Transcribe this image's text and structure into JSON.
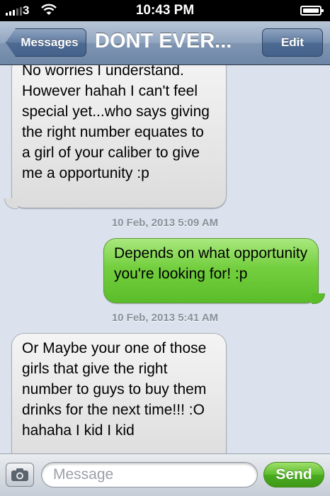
{
  "status_bar": {
    "carrier": "3",
    "time": "10:43 PM",
    "icons": [
      "signal-icon",
      "wifi-icon",
      "battery-icon"
    ]
  },
  "nav": {
    "back_label": "Messages",
    "title": "DONT EVER...",
    "edit_label": "Edit"
  },
  "messages": [
    {
      "direction": "incoming",
      "text": "No worries I understand. However hahah I can't feel special yet...who says giving the right number equates to a girl of your caliber to give me a opportunity :p"
    },
    {
      "direction": "outgoing",
      "text": "Depends on what opportunity you're looking for! :p"
    },
    {
      "direction": "incoming",
      "text": "Or Maybe your one of those girls that give the right number to guys to buy them drinks for the next time!!! :O hahaha I kid I kid"
    }
  ],
  "timestamps": [
    "10 Feb, 2013 5:09 AM",
    "10 Feb, 2013 5:41 AM"
  ],
  "input_bar": {
    "placeholder": "Message",
    "value": "",
    "send_label": "Send",
    "camera_icon": "camera-icon"
  },
  "colors": {
    "outgoing_bubble": "#74cf3f",
    "incoming_bubble": "#e8e8e8",
    "background": "#dbe2ed",
    "nav_bar": "#7f95b2"
  }
}
